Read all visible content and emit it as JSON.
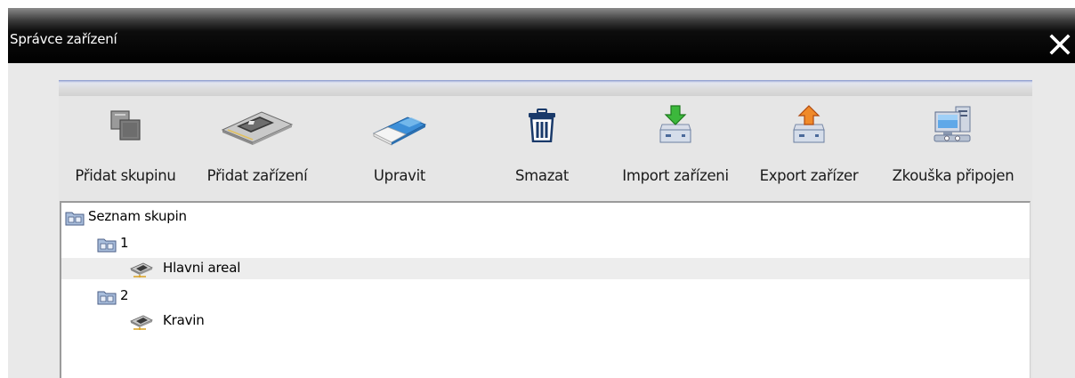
{
  "window": {
    "title": "Správce zařízení"
  },
  "toolbar": {
    "add_group": "Přidat skupinu",
    "add_device": "Přidat zařízení",
    "edit": "Upravit",
    "delete": "Smazat",
    "import": "Import zařízeni",
    "export": "Export zařízer",
    "test_connection": "Zkouška připojen"
  },
  "tree": {
    "root": "Seznam skupin",
    "groups": [
      {
        "label": "1",
        "devices": [
          {
            "label": "Hlavni areal",
            "selected": true
          }
        ]
      },
      {
        "label": "2",
        "devices": [
          {
            "label": "Kravin",
            "selected": false
          }
        ]
      }
    ]
  },
  "colors": {
    "titlebar": "#000000",
    "body": "#e9e9e9",
    "panel_stripe": "#8896c8",
    "selection": "#ededed"
  }
}
